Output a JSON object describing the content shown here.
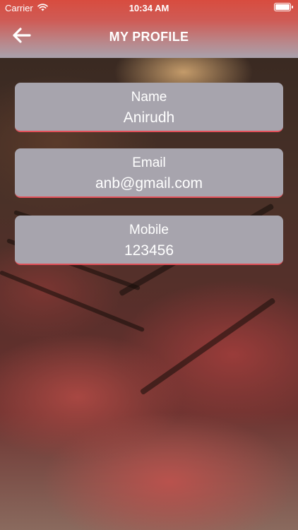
{
  "status_bar": {
    "carrier": "Carrier",
    "time": "10:34 AM"
  },
  "nav": {
    "title": "MY PROFILE"
  },
  "profile": {
    "name_label": "Name",
    "name_value": "Anirudh",
    "email_label": "Email",
    "email_value": "anb@gmail.com",
    "mobile_label": "Mobile",
    "mobile_value": "123456"
  },
  "icons": {
    "back": "arrow-left-icon",
    "wifi": "wifi-icon",
    "battery": "battery-icon"
  },
  "colors": {
    "header_top": "#d84c3f",
    "card_bg": "#a7a4ad",
    "card_accent": "#e2515a"
  }
}
